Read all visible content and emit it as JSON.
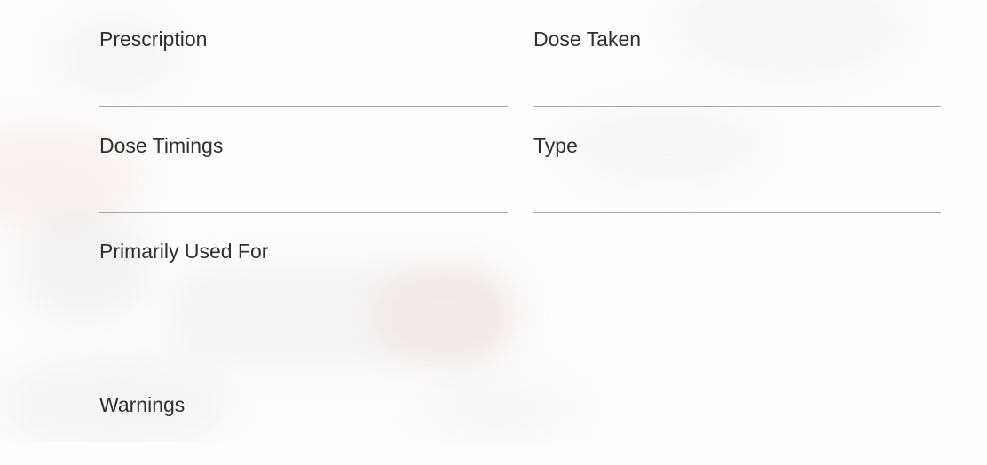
{
  "form": {
    "prescription": {
      "label": "Prescription",
      "value": ""
    },
    "dose_taken": {
      "label": "Dose Taken",
      "value": ""
    },
    "dose_timings": {
      "label": "Dose Timings",
      "value": ""
    },
    "type": {
      "label": "Type",
      "value": ""
    },
    "primarily_used_for": {
      "label": "Primarily Used For",
      "value": ""
    },
    "warnings": {
      "label": "Warnings",
      "value": ""
    }
  }
}
